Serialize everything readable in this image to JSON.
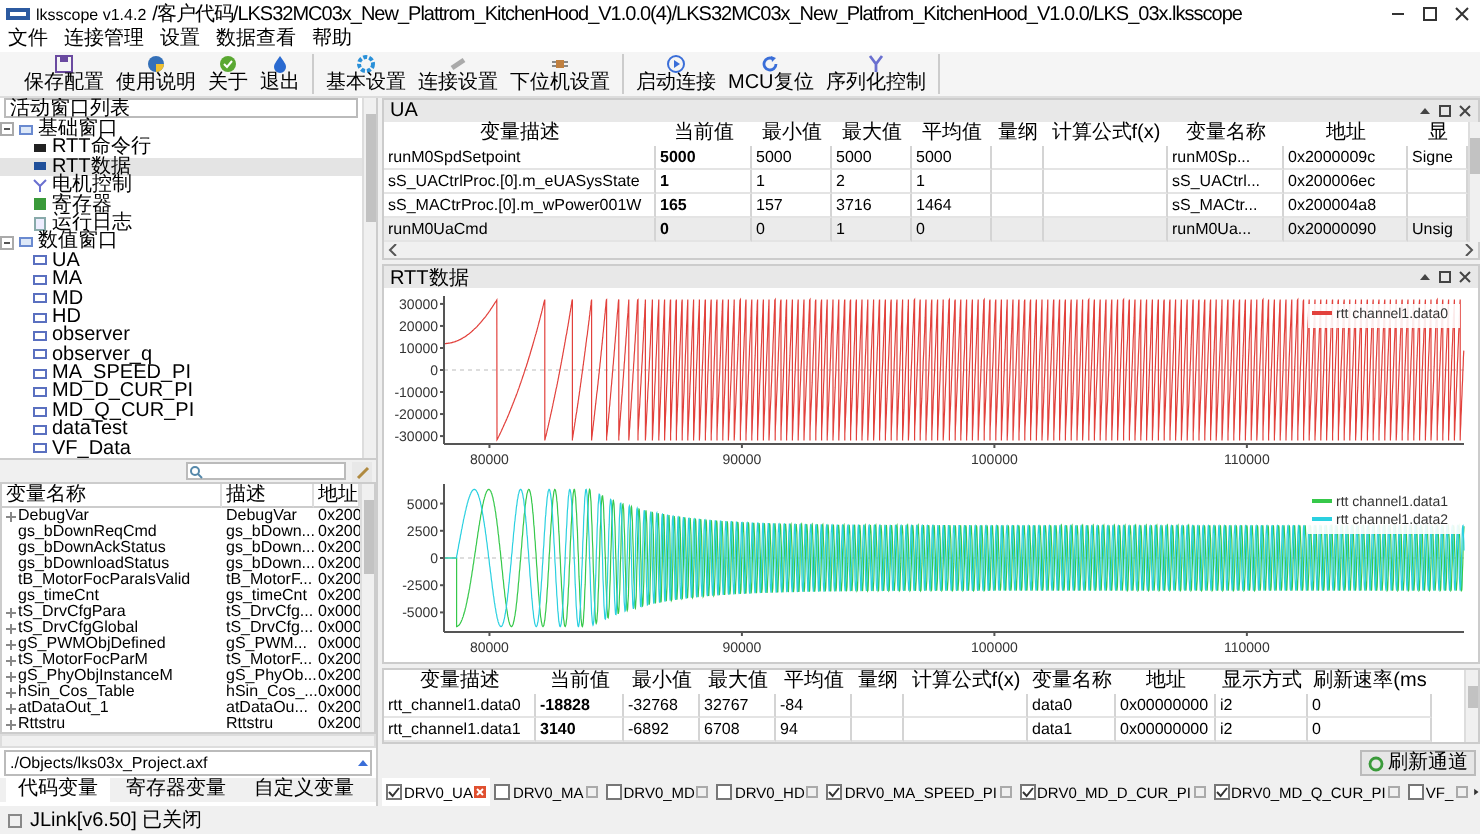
{
  "window": {
    "app_name": "lksscope v1.4.2",
    "path": "/客户代码/LKS32MC03x_New_Plattrom_KitchenHood_V1.0.0(4)/LKS32MC03x_New_Platfrom_KitchenHood_V1.0.0/LKS_03x.lksscope"
  },
  "menu": [
    "文件",
    "连接管理",
    "设置",
    "数据查看",
    "帮助"
  ],
  "toolbar": [
    [
      {
        "label": "保存配置",
        "kind": "save"
      },
      {
        "label": "使用说明",
        "kind": "ball"
      },
      {
        "label": "关于",
        "kind": "check"
      },
      {
        "label": "退出",
        "kind": "drop"
      }
    ],
    [
      {
        "label": "基本设置",
        "kind": "gear"
      },
      {
        "label": "连接设置",
        "kind": "link"
      },
      {
        "label": "下位机设置",
        "kind": "chip"
      }
    ],
    [
      {
        "label": "启动连接",
        "kind": "play"
      },
      {
        "label": "MCU复位",
        "kind": "refresh"
      },
      {
        "label": "序列化控制",
        "kind": "fork"
      }
    ]
  ],
  "tree": {
    "title": "活动窗口列表",
    "items": [
      {
        "label": "基础窗口",
        "expanded": true,
        "selected": false,
        "children": [
          {
            "label": "RTT命令行",
            "kind": "terminal",
            "selected": false
          },
          {
            "label": "RTT数据",
            "kind": "data",
            "selected": true
          },
          {
            "label": "电机控制",
            "kind": "motor",
            "selected": false
          },
          {
            "label": "寄存器",
            "kind": "register",
            "selected": false
          },
          {
            "label": "运行日志",
            "kind": "log",
            "selected": false
          }
        ]
      },
      {
        "label": "数值窗口",
        "expanded": true,
        "selected": false,
        "children": [
          {
            "label": "UA",
            "kind": "window",
            "selected": false
          },
          {
            "label": "MA",
            "kind": "window",
            "selected": false
          },
          {
            "label": "MD",
            "kind": "window",
            "selected": false
          },
          {
            "label": "HD",
            "kind": "window",
            "selected": false
          },
          {
            "label": "observer",
            "kind": "window",
            "selected": false
          },
          {
            "label": "observer_q",
            "kind": "window",
            "selected": false
          },
          {
            "label": "MA_SPEED_PI",
            "kind": "window",
            "selected": false
          },
          {
            "label": "MD_D_CUR_PI",
            "kind": "window",
            "selected": false
          },
          {
            "label": "MD_Q_CUR_PI",
            "kind": "window",
            "selected": false
          },
          {
            "label": "dataTest",
            "kind": "window",
            "selected": false
          },
          {
            "label": "VF_Data",
            "kind": "window",
            "selected": false
          }
        ]
      }
    ]
  },
  "variables": {
    "columns": [
      "变量名称",
      "描述",
      "地址"
    ],
    "rows": [
      {
        "name": "DebugVar",
        "has_children": true,
        "description": "DebugVar",
        "address": "0x200"
      },
      {
        "name": "gs_bDownReqCmd",
        "has_children": false,
        "description": "gs_bDown...",
        "address": "0x200"
      },
      {
        "name": "gs_bDownAckStatus",
        "has_children": false,
        "description": "gs_bDown...",
        "address": "0x200"
      },
      {
        "name": "gs_bDownloadStatus",
        "has_children": false,
        "description": "gs_bDown...",
        "address": "0x200"
      },
      {
        "name": "tB_MotorFocParaIsValid",
        "has_children": false,
        "description": "tB_MotorF...",
        "address": "0x200"
      },
      {
        "name": "gs_timeCnt",
        "has_children": false,
        "description": "gs_timeCnt",
        "address": "0x200"
      },
      {
        "name": "tS_DrvCfgPara",
        "has_children": true,
        "description": "tS_DrvCfg...",
        "address": "0x000"
      },
      {
        "name": "tS_DrvCfgGlobal",
        "has_children": true,
        "description": "tS_DrvCfg...",
        "address": "0x000"
      },
      {
        "name": "gS_PWMObjDefined",
        "has_children": true,
        "description": "gS_PWM...",
        "address": "0x000"
      },
      {
        "name": "tS_MotorFocParM",
        "has_children": true,
        "description": "tS_MotorF...",
        "address": "0x200"
      },
      {
        "name": "gS_PhyObjInstanceM",
        "has_children": true,
        "description": "gS_PhyOb...",
        "address": "0x200"
      },
      {
        "name": "hSin_Cos_Table",
        "has_children": true,
        "description": "hSin_Cos_...",
        "address": "0x000"
      },
      {
        "name": "atDataOut_1",
        "has_children": true,
        "description": "atDataOu...",
        "address": "0x200"
      },
      {
        "name": "Rttstru",
        "has_children": true,
        "description": "Rttstru",
        "address": "0x200"
      }
    ]
  },
  "file_path": "./Objects/lks03x_Project.axf",
  "variable_tabs": [
    {
      "label": "代码变量",
      "selected": true
    },
    {
      "label": "寄存器变量",
      "selected": false
    },
    {
      "label": "自定义变量",
      "selected": false
    }
  ],
  "status": "JLink[v6.50] 已关闭",
  "ua_panel": {
    "title": "UA",
    "columns": [
      "变量描述",
      "当前值",
      "最小值",
      "最大值",
      "平均值",
      "量纲",
      "计算公式f(x)",
      "变量名称",
      "地址",
      "显"
    ],
    "rows": [
      {
        "description": "runM0SpdSetpoint",
        "current": "5000",
        "min": "5000",
        "max": "5000",
        "average": "5000",
        "var_name": "runM0Sp...",
        "address": "0x2000009c",
        "display": "Signe",
        "selected": false
      },
      {
        "description": "sS_UACtrlProc.[0].m_eUASysState",
        "current": "1",
        "min": "1",
        "max": "2",
        "average": "1",
        "var_name": "sS_UACtrl...",
        "address": "0x200006ec",
        "selected": false
      },
      {
        "description": "sS_MACtrProc.[0].m_wPower001W",
        "current": "165",
        "min": "157",
        "max": "3716",
        "average": "1464",
        "var_name": "sS_MACtr...",
        "address": "0x200004a8",
        "selected": false
      },
      {
        "description": "runM0UaCmd",
        "current": "0",
        "min": "0",
        "max": "1",
        "average": "0",
        "var_name": "runM0Ua...",
        "address": "0x20000090",
        "display": "Unsig",
        "selected": true
      }
    ]
  },
  "rtt_panel": {
    "title": "RTT数据",
    "charts": [
      {
        "kind": "sawtooth",
        "y_ticks": [
          "30000",
          "20000",
          "10000",
          "0",
          "-10000",
          "-20000",
          "-30000"
        ],
        "x_ticks": [
          "80000",
          "90000",
          "100000",
          "110000"
        ],
        "legend": [
          {
            "label": "rtt channel1.data0",
            "color": "#e2413c"
          }
        ]
      },
      {
        "kind": "chirp",
        "y_ticks": [
          "5000",
          "2500",
          "0",
          "-2500",
          "-5000"
        ],
        "x_ticks": [
          "80000",
          "90000",
          "100000",
          "110000"
        ],
        "legend": [
          {
            "label": "rtt channel1.data1",
            "color": "#36c84a"
          },
          {
            "label": "rtt channel1.data2",
            "color": "#2ad0e0"
          }
        ]
      }
    ]
  },
  "channel_table": {
    "columns": [
      "变量描述",
      "当前值",
      "最小值",
      "最大值",
      "平均值",
      "量纲",
      "计算公式f(x)",
      "变量名称",
      "地址",
      "显示方式",
      "刷新速率(ms"
    ],
    "rows": [
      {
        "description": "rtt_channel1.data0",
        "current": "-18828",
        "min": "-32768",
        "max": "32767",
        "average": "-84",
        "var_name": "data0",
        "address": "0x00000000",
        "display": "i2",
        "rate": "0",
        "selected": false
      },
      {
        "description": "rtt_channel1.data1",
        "current": "3140",
        "min": "-6892",
        "max": "6708",
        "average": "94",
        "var_name": "data1",
        "address": "0x00000000",
        "display": "i2",
        "rate": "0",
        "selected": false
      }
    ]
  },
  "refresh_button": "刷新通道",
  "window_tabs": [
    {
      "label": "DRV0_UA",
      "checked": true,
      "selected": true
    },
    {
      "label": "DRV0_MA",
      "checked": false,
      "selected": false
    },
    {
      "label": "DRV0_MD",
      "checked": false,
      "selected": false
    },
    {
      "label": "DRV0_HD",
      "checked": false,
      "selected": false
    },
    {
      "label": "DRV0_MA_SPEED_PI",
      "checked": true,
      "selected": false
    },
    {
      "label": "DRV0_MD_D_CUR_PI",
      "checked": true,
      "selected": false
    },
    {
      "label": "DRV0_MD_Q_CUR_PI",
      "checked": true,
      "selected": false
    },
    {
      "label": "VF_",
      "checked": false,
      "selected": false
    }
  ]
}
